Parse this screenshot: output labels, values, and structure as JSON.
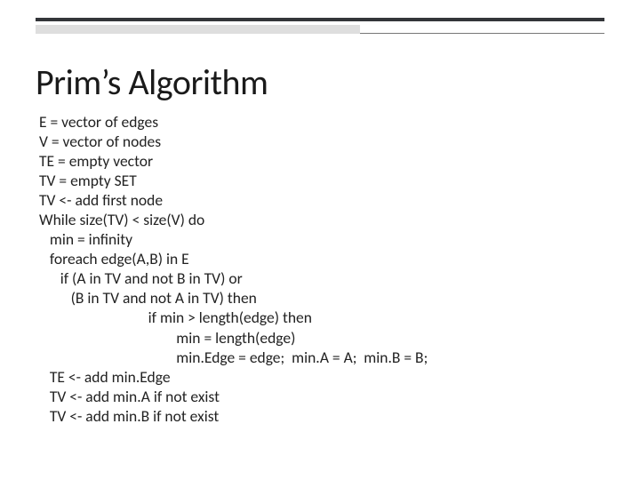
{
  "title": "Prim’s Algorithm",
  "pseudocode": {
    "l01": "E = vector of edges",
    "l02": "V = vector of nodes",
    "l03": "TE = empty vector",
    "l04": "TV = empty SET",
    "l05": "TV <- add first node",
    "l06": "While size(TV) < size(V) do",
    "l07": "   min = infinity",
    "l08": "   foreach edge(A,B) in E",
    "l09": "      if (A in TV and not B in TV) or",
    "l10": "         (B in TV and not A in TV) then",
    "l11": "                               if min > length(edge) then",
    "l12": "                                       min = length(edge)",
    "l13": "                                       min.Edge = edge;  min.A = A;  min.B = B;",
    "l14": "   TE <- add min.Edge",
    "l15": "   TV <- add min.A if not exist",
    "l16": "   TV <- add min.B if not exist"
  }
}
